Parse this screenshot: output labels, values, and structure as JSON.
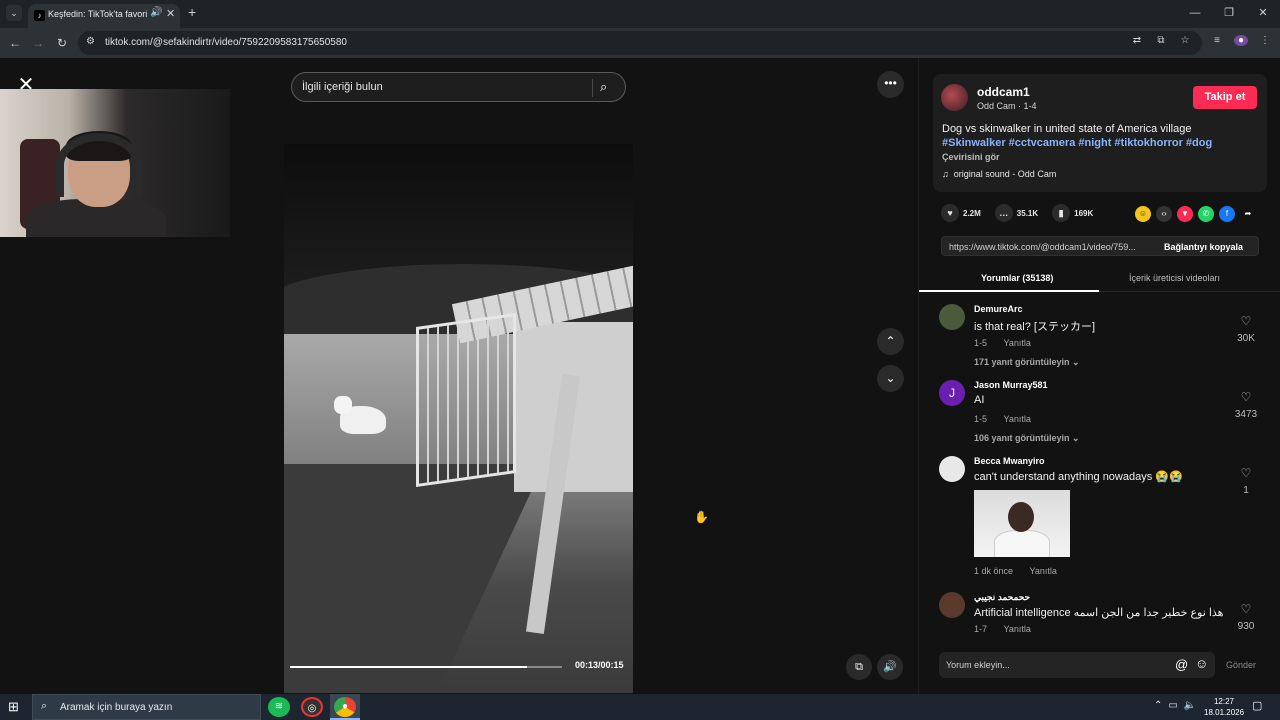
{
  "browser": {
    "tab_title": "Keşfedin: TikTok'ta favori vi",
    "url": "tiktok.com/@sefakindirtr/video/7592209583175650580"
  },
  "search": {
    "placeholder": "İlgili içeriği bulun"
  },
  "video": {
    "time": "00:13/00:15",
    "progress": 0.87
  },
  "post": {
    "author": "oddcam1",
    "author_sub": "Odd Cam · 1-4",
    "follow_label": "Takip et",
    "description": "Dog vs skinwalker in united state of America village",
    "hashtags": "#Skinwalker #cctvcamera #night #tiktokhorror #dog",
    "translate_label": "Çevirisini gör",
    "sound": "original sound - Odd Cam",
    "likes": "2.2M",
    "comments": "35.1K",
    "saves": "169K",
    "link": "https://www.tiktok.com/@oddcam1/video/759...",
    "copy_label": "Bağlantıyı kopyala"
  },
  "tabs": {
    "comments": "Yorumlar (35138)",
    "creator_videos": "İçerik üreticisi videoları"
  },
  "comments": [
    {
      "name": "DemureArc",
      "text": "is that real? [ステッカー]",
      "date": "1-5",
      "reply": "Yanıtla",
      "likes": "30K",
      "replies": "171 yanıt görüntüleyin"
    },
    {
      "name": "Jason Murray581",
      "text": "AI",
      "date": "1-5",
      "reply": "Yanıtla",
      "likes": "3473",
      "replies": "106 yanıt görüntüleyin",
      "avatar_letter": "J"
    },
    {
      "name": "Becca Mwanyiro",
      "text": "can't understand anything nowadays 😭😭",
      "date": "1 dk önce",
      "reply": "Yanıtla",
      "likes": "1"
    },
    {
      "name": "ححمحمد نجيبي",
      "text": "Artificial intelligence هذا نوع خطير جدا من الجن اسمه",
      "date": "1-7",
      "reply": "Yanıtla",
      "likes": "930"
    }
  ],
  "comment_input": {
    "placeholder": "Yorum ekleyin...",
    "send_label": "Gönder"
  },
  "taskbar": {
    "search_placeholder": "Aramak için buraya yazın",
    "time": "12:27",
    "date": "18.01.2026"
  },
  "colors": {
    "accent": "#fe2c55",
    "hashtag": "#8ab4f8"
  }
}
